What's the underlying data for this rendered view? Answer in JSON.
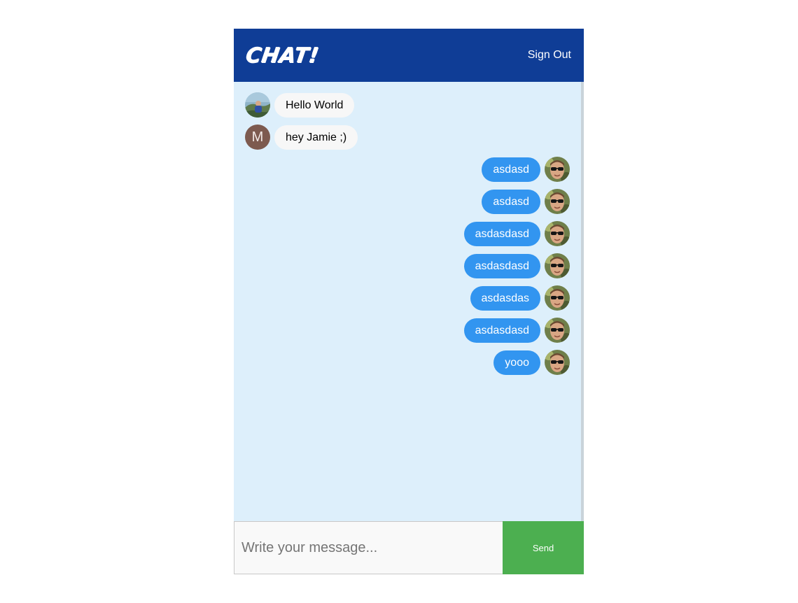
{
  "header": {
    "logo_text": "CHAT!",
    "sign_out_label": "Sign Out"
  },
  "messages": [
    {
      "direction": "received",
      "avatar": "photo-avatar-landscape",
      "text": "Hello World"
    },
    {
      "direction": "received",
      "avatar": "letter-avatar",
      "avatar_letter": "M",
      "text": "hey Jamie ;)"
    },
    {
      "direction": "sent",
      "avatar": "photo-avatar-sunglasses",
      "text": "asdasd"
    },
    {
      "direction": "sent",
      "avatar": "photo-avatar-sunglasses",
      "text": "asdasd"
    },
    {
      "direction": "sent",
      "avatar": "photo-avatar-sunglasses",
      "text": "asdasdasd"
    },
    {
      "direction": "sent",
      "avatar": "photo-avatar-sunglasses",
      "text": "asdasdasd"
    },
    {
      "direction": "sent",
      "avatar": "photo-avatar-sunglasses",
      "text": "asdasdas"
    },
    {
      "direction": "sent",
      "avatar": "photo-avatar-sunglasses",
      "text": "asdasdasd"
    },
    {
      "direction": "sent",
      "avatar": "photo-avatar-sunglasses",
      "text": "yooo"
    }
  ],
  "composer": {
    "placeholder": "Write your message...",
    "value": "",
    "send_label": "Send"
  },
  "colors": {
    "header_bg": "#0f3d96",
    "messages_bg": "#ddeffb",
    "sent_bubble": "#3295f0",
    "received_bubble": "#f7f7f7",
    "send_button": "#4caf50"
  }
}
